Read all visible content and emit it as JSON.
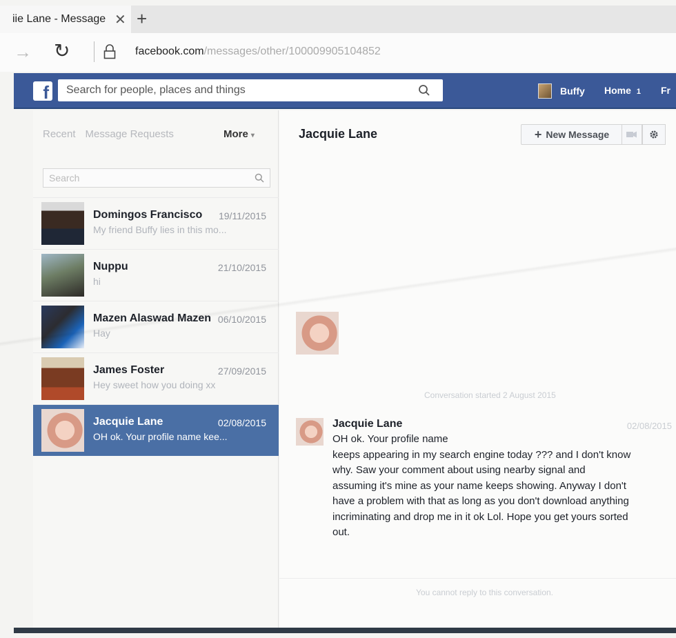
{
  "browser": {
    "tab_title": "iie Lane - Message",
    "close_glyph": "✕",
    "new_tab_glyph": "+",
    "forward_glyph": "→",
    "reload_glyph": "↻",
    "url_host": "facebook.com",
    "url_path": "/messages/other/100009905104852"
  },
  "fb": {
    "logo": "f",
    "search_placeholder": "Search for people, places and things",
    "user_name": "Buffy",
    "home_label": "Home",
    "home_count": "1",
    "friends_label": "Fr"
  },
  "sidebar": {
    "tabs": [
      "Recent",
      "Message Requests"
    ],
    "more_label": "More",
    "more_caret": "▾",
    "search_placeholder": "Search",
    "conversations": [
      {
        "name": "Domingos Francisco",
        "date": "19/11/2015",
        "preview": "My friend Buffy lies in this mo..."
      },
      {
        "name": "Nuppu",
        "date": "21/10/2015",
        "preview": "hi"
      },
      {
        "name": "Mazen Alaswad Mazen",
        "date": "06/10/2015",
        "preview": "Hay"
      },
      {
        "name": "James Foster",
        "date": "27/09/2015",
        "preview": "Hey sweet how you doing xx"
      },
      {
        "name": "Jacquie Lane",
        "date": "02/08/2015",
        "preview": "OH ok. Your profile name kee..."
      }
    ]
  },
  "main": {
    "title": "Jacquie Lane",
    "new_message_plus": "+",
    "new_message_label": "New Message",
    "conversation_started": "Conversation started 2 August 2015",
    "message": {
      "sender": "Jacquie Lane",
      "date": "02/08/2015",
      "lines": [
        "OH ok. Your profile name",
        "keeps appearing in my search engine today ??? and I don't know",
        "why. Saw your comment about using nearby signal  and",
        "assuming it's mine as your name keeps showing. Anyway I don't",
        "have a problem with that as long as you don't  download anything",
        "incriminating and drop me in it ok Lol. Hope you get yours sorted",
        "out."
      ]
    },
    "cannot_reply": "You cannot reply to this conversation."
  },
  "colors": {
    "facebook_blue": "#3b5998",
    "active_row": "#4a6fa5"
  }
}
